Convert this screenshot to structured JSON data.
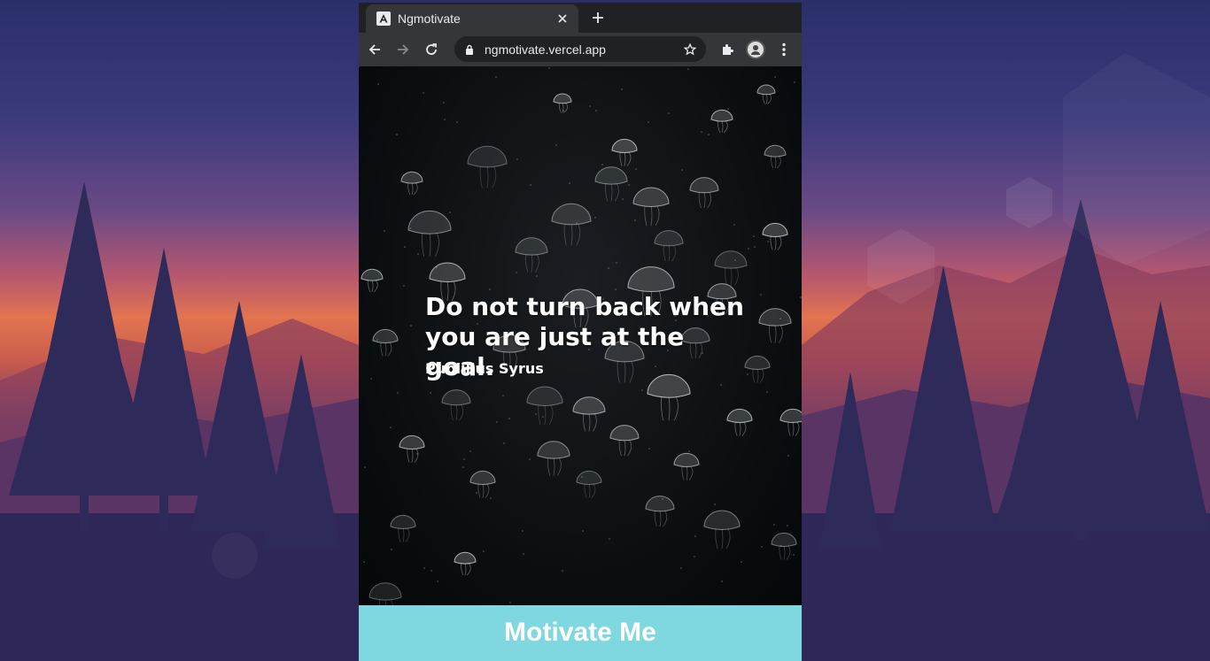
{
  "browser": {
    "tab": {
      "title": "Ngmotivate",
      "favicon": "angular-logo-icon"
    },
    "omnibox": {
      "url": "ngmotivate.vercel.app"
    },
    "icons": [
      "back-arrow-icon",
      "forward-arrow-icon",
      "reload-icon",
      "lock-icon",
      "star-icon",
      "extensions-icon",
      "profile-avatar",
      "more-vert-icon",
      "close-icon",
      "plus-icon"
    ]
  },
  "page": {
    "quote_line1": "Do not turn back when",
    "quote_line2": "you are just at the goal.",
    "author": "Publilius Syrus",
    "button_label": "Motivate Me"
  },
  "colors": {
    "button_bg": "#7fd8e0",
    "toolbar_bg": "#35363a",
    "tabstrip_bg": "#202124"
  }
}
